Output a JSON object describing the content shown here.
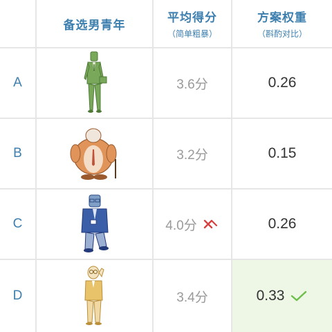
{
  "header": {
    "col1_title": "备选男青年",
    "col2_title": "平均得分",
    "col2_sub": "（简单粗暴）",
    "col3_title": "方案权重",
    "col3_sub": "（斟酌对比）"
  },
  "rows": [
    {
      "label": "A",
      "avatar": "slim-businessman-figure",
      "score": "3.6分",
      "weight": "0.26",
      "score_mark": "",
      "weight_mark": ""
    },
    {
      "label": "B",
      "avatar": "heavy-man-with-cane-figure",
      "score": "3.2分",
      "weight": "0.15",
      "score_mark": "",
      "weight_mark": ""
    },
    {
      "label": "C",
      "avatar": "man-in-blue-suit-figure",
      "score": "4.0分",
      "weight": "0.26",
      "score_mark": "cross-icon",
      "weight_mark": ""
    },
    {
      "label": "D",
      "avatar": "young-man-with-glasses-figure",
      "score": "3.4分",
      "weight": "0.33",
      "score_mark": "",
      "weight_mark": "check-icon"
    }
  ],
  "colors": {
    "accent": "#3d7fae",
    "cross": "#d94040",
    "check": "#6cbf4a",
    "highlight": "#eef6e6"
  }
}
